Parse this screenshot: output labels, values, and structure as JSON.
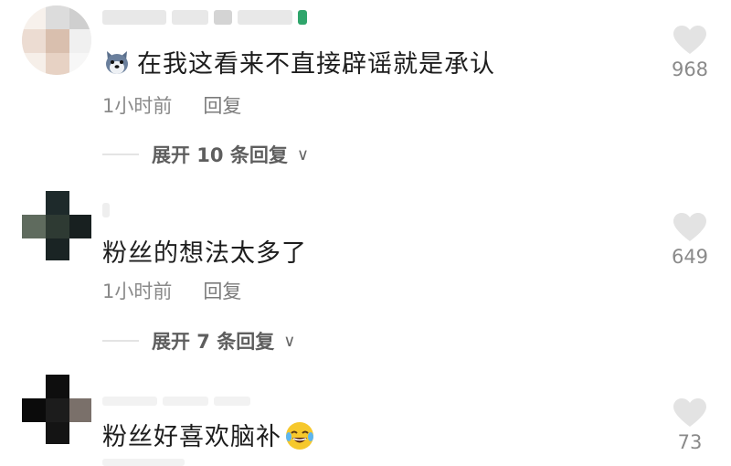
{
  "comments": [
    {
      "text": "在我这看来不直接辟谣就是承认",
      "time": "1小时前",
      "reply_label": "回复",
      "expand_label": "展开 10 条回复",
      "likes": "968",
      "leading_emoji": "dog-face-emoji"
    },
    {
      "text": "粉丝的想法太多了",
      "time": "1小时前",
      "reply_label": "回复",
      "expand_label": "展开 7 条回复",
      "likes": "649"
    },
    {
      "text": "粉丝好喜欢脑补",
      "likes": "73",
      "trailing_emoji": "crying-laughing-emoji"
    }
  ],
  "colors": {
    "text": "#1d1d1d",
    "meta": "#8a8a8a",
    "heart": "#e3e3e3",
    "expand": "#5e5e5e"
  }
}
